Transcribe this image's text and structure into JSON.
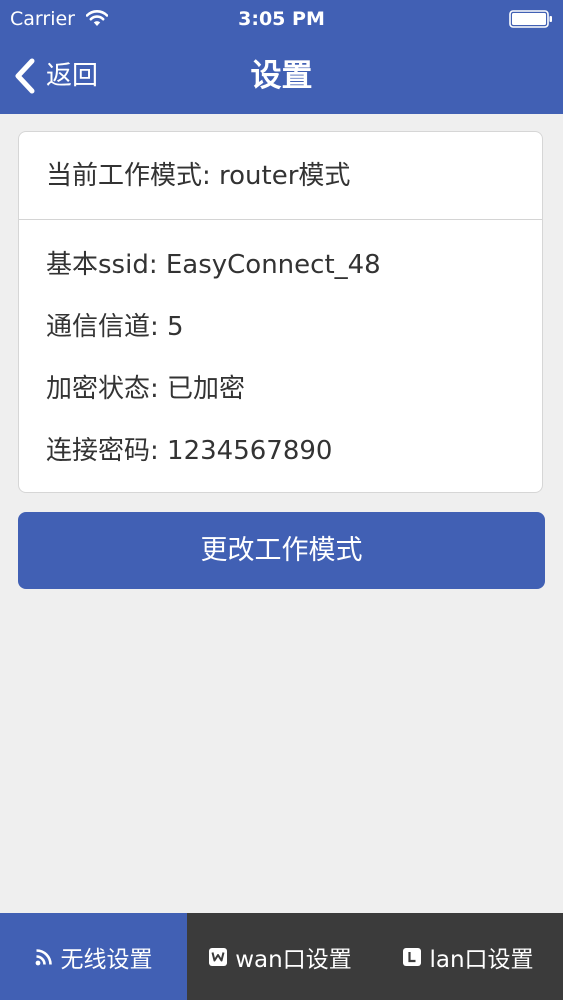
{
  "status_bar": {
    "carrier": "Carrier",
    "time": "3:05 PM"
  },
  "nav": {
    "back_label": "返回",
    "title": "设置"
  },
  "card": {
    "mode_line": "当前工作模式: router模式",
    "rows": [
      "基本ssid: EasyConnect_48",
      "通信信道: 5",
      "加密状态: 已加密",
      "连接密码: 1234567890"
    ]
  },
  "change_mode_button": "更改工作模式",
  "tabs": [
    {
      "label": "无线设置",
      "icon": "wifi-rss-icon",
      "active": true
    },
    {
      "label": "wan口设置",
      "icon": "wan-port-icon",
      "active": false
    },
    {
      "label": "lan口设置",
      "icon": "lan-port-icon",
      "active": false
    }
  ],
  "colors": {
    "accent": "#4160b4",
    "tab_bar": "#3b3b3b",
    "background": "#efefef",
    "text": "#333333"
  }
}
